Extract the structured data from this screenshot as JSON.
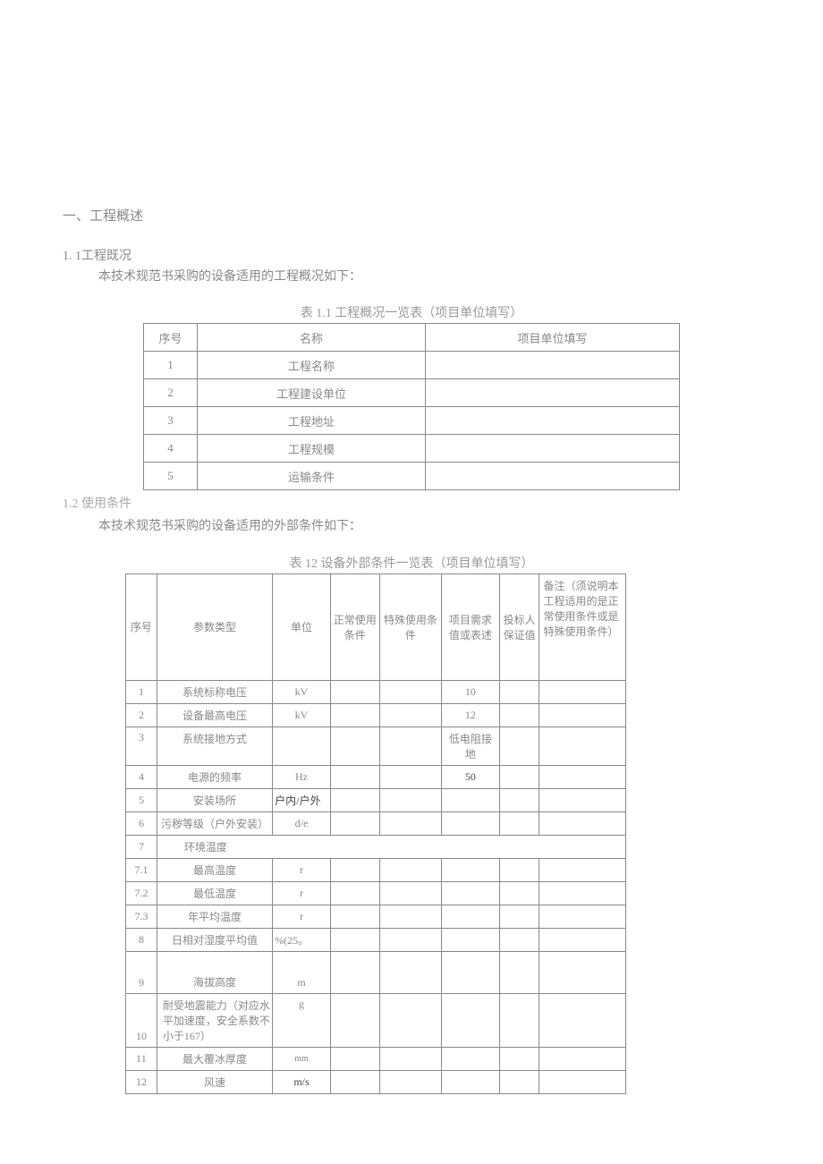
{
  "section1": {
    "heading": "一、工程概述",
    "sub1": {
      "heading": "1.  1工程既况",
      "body": "本技术规范书采购的设备适用的工程概况如下：",
      "caption": "表 1.1 工程概况一览表（项目单位填写）",
      "headers": [
        "序号",
        "名称",
        "项目单位填写"
      ],
      "rows": [
        {
          "seq": "1",
          "name": "工程名称",
          "val": ""
        },
        {
          "seq": "2",
          "name": "工程建设单位",
          "val": ""
        },
        {
          "seq": "3",
          "name": "工程地址",
          "val": ""
        },
        {
          "seq": "4",
          "name": "工程规模",
          "val": ""
        },
        {
          "seq": "5",
          "name": "运输条件",
          "val": ""
        }
      ]
    },
    "sub2": {
      "heading": "1.2 使用条件",
      "body": "本技术规范书采购的设备适用的外部条件如下：",
      "caption": "表 12 设备外部条件一览表（项目单位填写）",
      "headers": {
        "c1": "序号",
        "c2": "参数类型",
        "c3": "单位",
        "c4": "正常使用条件",
        "c5": "特殊使用条件",
        "c6": "项目需求值或表述",
        "c7": "投标人保证值",
        "c8": "备注（须说明本工程适用的是正常使用条件或是特殊使用条件）"
      },
      "rows": [
        {
          "seq": "1",
          "param": "系统标称电压",
          "unit": "kV",
          "normal": "",
          "special": "",
          "demand": "10",
          "bid": "",
          "remark": ""
        },
        {
          "seq": "2",
          "param": "设备最高电压",
          "unit": "kV",
          "normal": "",
          "special": "",
          "demand": "12",
          "bid": "",
          "remark": ""
        },
        {
          "seq": "3",
          "param": "系统接地方式",
          "unit": "",
          "normal": "",
          "special": "",
          "demand": "低电阻接地",
          "bid": "",
          "remark": ""
        },
        {
          "seq": "4",
          "param": "电源的频率",
          "unit": "Hz",
          "normal": "",
          "special": "",
          "demand": "50",
          "bid": "",
          "remark": ""
        },
        {
          "seq": "5",
          "param": "安装场所",
          "unit": "户内/户外",
          "normal": "",
          "special": "",
          "demand": "",
          "bid": "",
          "remark": ""
        },
        {
          "seq": "6",
          "param": "污秽等级（户外安装）",
          "unit": "d/e",
          "normal": "",
          "special": "",
          "demand": "",
          "bid": "",
          "remark": ""
        },
        {
          "seq": "7",
          "param": "环境温度"
        },
        {
          "seq": "7.1",
          "param": "最高温度",
          "unit": "r",
          "normal": "",
          "special": "",
          "demand": "",
          "bid": "",
          "remark": ""
        },
        {
          "seq": "7.2",
          "param": "最低温度",
          "unit": "r",
          "normal": "",
          "special": "",
          "demand": "",
          "bid": "",
          "remark": ""
        },
        {
          "seq": "7.3",
          "param": "年平均温度",
          "unit": "r",
          "normal": "",
          "special": "",
          "demand": "",
          "bid": "",
          "remark": ""
        },
        {
          "seq": "8",
          "param": "日相对湿度平均值",
          "unit": "%(25。",
          "normal": "",
          "special": "",
          "demand": "",
          "bid": "",
          "remark": ""
        },
        {
          "seq": "9",
          "param": "海拔高度",
          "unit": "m",
          "normal": "",
          "special": "",
          "demand": "",
          "bid": "",
          "remark": ""
        },
        {
          "seq": "10",
          "param": "耐受地震能力（对应水平加速度，安全系数不小于167）",
          "unit": "g",
          "normal": "",
          "special": "",
          "demand": "",
          "bid": "",
          "remark": ""
        },
        {
          "seq": "11",
          "param": "最大覆冰厚度",
          "unit": "mm",
          "normal": "",
          "special": "",
          "demand": "",
          "bid": "",
          "remark": ""
        },
        {
          "seq": "12",
          "param": "风速",
          "unit": "m/s",
          "normal": "",
          "special": "",
          "demand": "",
          "bid": "",
          "remark": ""
        }
      ]
    }
  }
}
